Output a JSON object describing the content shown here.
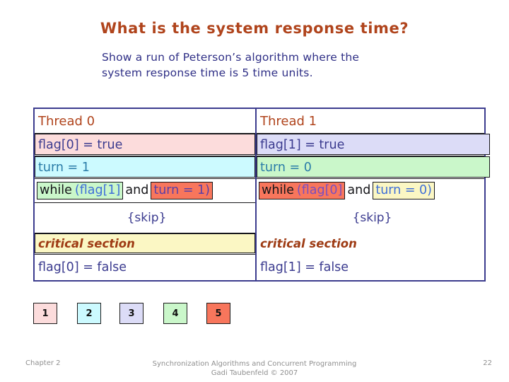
{
  "slide": {
    "title": "What is the system response time?",
    "subtitle": "Show a run of Peterson’s algorithm where the\nsystem response time is 5 time units."
  },
  "table": {
    "columns": [
      {
        "header": "Thread 0"
      },
      {
        "header": "Thread 1"
      }
    ],
    "left": {
      "header": "Thread 0",
      "line_flag_true": "flag[0] = true",
      "line_turn": "turn = 1",
      "while_while": "while",
      "while_cond1": "(flag[1]",
      "while_and": "and",
      "while_cond2": "turn = 1)",
      "line_skip": "{skip}",
      "line_critical": "critical section",
      "line_flag_false": "flag[0] = false"
    },
    "right": {
      "header": "Thread 1",
      "line_flag_true": "flag[1] = true",
      "line_turn": "turn = 0",
      "while_while": "while",
      "while_cond1": "(flag[0]",
      "while_and": "and",
      "while_cond2": "turn = 0)",
      "line_skip": "{skip}",
      "line_critical": "critical section",
      "line_flag_false": "flag[1] = false"
    }
  },
  "legend": {
    "steps": [
      {
        "label": "1",
        "color": "#fcdcdc"
      },
      {
        "label": "2",
        "color": "#ccfaff"
      },
      {
        "label": "3",
        "color": "#dcdcf7"
      },
      {
        "label": "4",
        "color": "#caf7ca"
      },
      {
        "label": "5",
        "color": "#f8765c"
      }
    ]
  },
  "colors": {
    "title": "#b0441c",
    "subtitle": "#2f2f86",
    "table_border": "#3c3c8e",
    "code_text": "#3b3b8f",
    "header_text": "#b0441c",
    "critical_text": "#9e3b14",
    "step1_pink": "#fcdcdc",
    "step2_cyan": "#ccfaff",
    "step3_lavender": "#dcdcf7",
    "step4_green": "#caf7ca",
    "step5_salmon": "#f8765c",
    "critical_yellow": "#fbf7c4",
    "footer_gray": "#8f8f8f"
  },
  "footer": {
    "chapter": "Chapter 2",
    "center": "Synchronization Algorithms and Concurrent Programming\nGadi Taubenfeld © 2007",
    "page": "22"
  }
}
